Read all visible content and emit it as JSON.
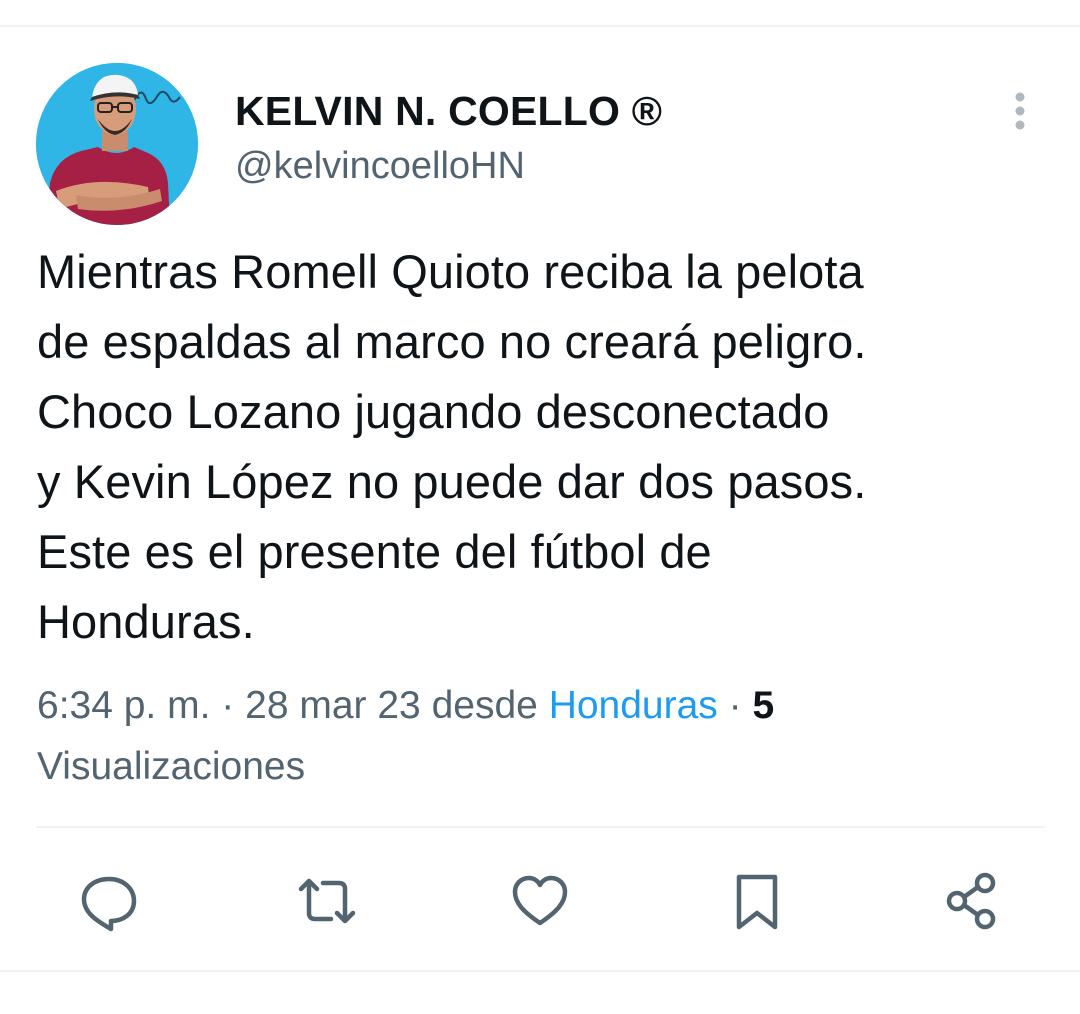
{
  "author": {
    "display_name": "KELVIN N. COELLO ®",
    "handle": "@kelvincoelloHN"
  },
  "tweet": {
    "text": "Mientras Romell Quioto reciba la pelota\nde espaldas al marco no creará peligro.\nChoco Lozano jugando desconectado\ny Kevin López no puede dar dos pasos.\nEste es el presente del fútbol de\nHonduras.",
    "time": "6:34 p. m.",
    "separator": "·",
    "date": "28 mar 23",
    "from_label": "desde",
    "place": "Honduras",
    "views_count": "5",
    "views_label": "Visualizaciones"
  },
  "actions": [
    {
      "icon": "reply-icon"
    },
    {
      "icon": "retweet-icon"
    },
    {
      "icon": "like-icon"
    },
    {
      "icon": "bookmark-icon"
    },
    {
      "icon": "share-icon"
    }
  ],
  "colors": {
    "text_primary": "#0f1419",
    "text_secondary": "#536471",
    "link": "#1d9bf0",
    "divider": "#eff3f4",
    "avatar_background": "#2fb6e6"
  }
}
